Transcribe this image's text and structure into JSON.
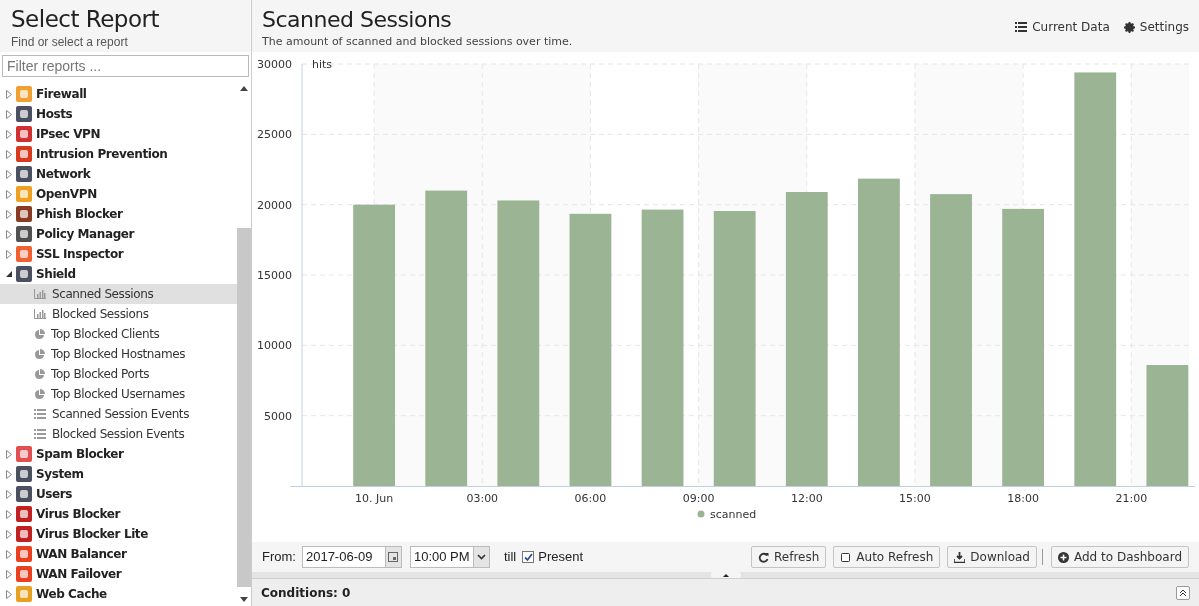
{
  "sidebar": {
    "title": "Select Report",
    "subtitle": "Find or select a report",
    "filter": {
      "placeholder": "Filter reports ..."
    },
    "items": [
      {
        "label": "Firewall",
        "color": "#f0a030",
        "expanded": false,
        "selected": false
      },
      {
        "label": "Hosts",
        "color": "#4a5060",
        "expanded": false,
        "selected": false
      },
      {
        "label": "IPsec VPN",
        "color": "#d03030",
        "expanded": false,
        "selected": false
      },
      {
        "label": "Intrusion Prevention",
        "color": "#d83a20",
        "expanded": false,
        "selected": false
      },
      {
        "label": "Network",
        "color": "#4a5060",
        "expanded": false,
        "selected": false
      },
      {
        "label": "OpenVPN",
        "color": "#f0a020",
        "expanded": false,
        "selected": false
      },
      {
        "label": "Phish Blocker",
        "color": "#8a3a20",
        "expanded": false,
        "selected": false
      },
      {
        "label": "Policy Manager",
        "color": "#505050",
        "expanded": false,
        "selected": false
      },
      {
        "label": "SSL Inspector",
        "color": "#f06030",
        "expanded": false,
        "selected": false
      },
      {
        "label": "Shield",
        "color": "#4a5060",
        "expanded": true,
        "selected": false,
        "children": [
          {
            "label": "Scanned Sessions",
            "kind": "bar",
            "selected": true
          },
          {
            "label": "Blocked Sessions",
            "kind": "bar",
            "selected": false
          },
          {
            "label": "Top Blocked Clients",
            "kind": "pie",
            "selected": false
          },
          {
            "label": "Top Blocked Hostnames",
            "kind": "pie",
            "selected": false
          },
          {
            "label": "Top Blocked Ports",
            "kind": "pie",
            "selected": false
          },
          {
            "label": "Top Blocked Usernames",
            "kind": "pie",
            "selected": false
          },
          {
            "label": "Scanned Session Events",
            "kind": "list",
            "selected": false
          },
          {
            "label": "Blocked Session Events",
            "kind": "list",
            "selected": false
          }
        ]
      },
      {
        "label": "Spam Blocker",
        "color": "#e05050",
        "expanded": false,
        "selected": false
      },
      {
        "label": "System",
        "color": "#4a5060",
        "expanded": false,
        "selected": false
      },
      {
        "label": "Users",
        "color": "#4a5060",
        "expanded": false,
        "selected": false
      },
      {
        "label": "Virus Blocker",
        "color": "#c02020",
        "expanded": false,
        "selected": false
      },
      {
        "label": "Virus Blocker Lite",
        "color": "#c02020",
        "expanded": false,
        "selected": false
      },
      {
        "label": "WAN Balancer",
        "color": "#e84020",
        "expanded": false,
        "selected": false
      },
      {
        "label": "WAN Failover",
        "color": "#e84020",
        "expanded": false,
        "selected": false
      },
      {
        "label": "Web Cache",
        "color": "#e8a020",
        "expanded": false,
        "selected": false
      }
    ]
  },
  "report": {
    "title": "Scanned Sessions",
    "subtitle": "The amount of scanned and blocked sessions over time.",
    "actions": [
      {
        "label": "Current Data",
        "kind": "list"
      },
      {
        "label": "Settings",
        "kind": "gear"
      }
    ],
    "chart_data": {
      "type": "bar",
      "ylabel": "hits",
      "x": [
        0,
        2,
        4,
        6,
        8,
        10,
        12,
        14,
        16,
        18,
        20,
        22
      ],
      "series": [
        {
          "name": "scanned",
          "color": "#9ab494",
          "values": [
            20000,
            21000,
            20300,
            19350,
            19650,
            19550,
            20900,
            21850,
            20750,
            19700,
            29400,
            8600
          ]
        }
      ],
      "xlim": [
        -2,
        22.6
      ],
      "ylim": [
        0,
        30000
      ],
      "xticks": [
        {
          "value": 0,
          "label": "10. Jun"
        },
        {
          "value": 3,
          "label": "03:00"
        },
        {
          "value": 6,
          "label": "06:00"
        },
        {
          "value": 9,
          "label": "09:00"
        },
        {
          "value": 12,
          "label": "12:00"
        },
        {
          "value": 15,
          "label": "15:00"
        },
        {
          "value": 18,
          "label": "18:00"
        },
        {
          "value": 21,
          "label": "21:00"
        }
      ],
      "yticks": [
        5000,
        10000,
        15000,
        20000,
        25000,
        30000
      ],
      "grid": true
    },
    "toolbar": {
      "from_label": "From:",
      "date": "2017-06-09",
      "time": "10:00 PM",
      "till_label": "till",
      "present": {
        "label": "Present",
        "checked": true
      },
      "buttons": [
        {
          "label": "Refresh",
          "kind": "refresh"
        },
        {
          "label": "Auto Refresh",
          "kind": "checkbox"
        },
        {
          "label": "Download",
          "kind": "download"
        },
        {
          "label": "Add to Dashboard",
          "kind": "add"
        }
      ]
    },
    "conditions": {
      "label": "Conditions: 0"
    }
  }
}
